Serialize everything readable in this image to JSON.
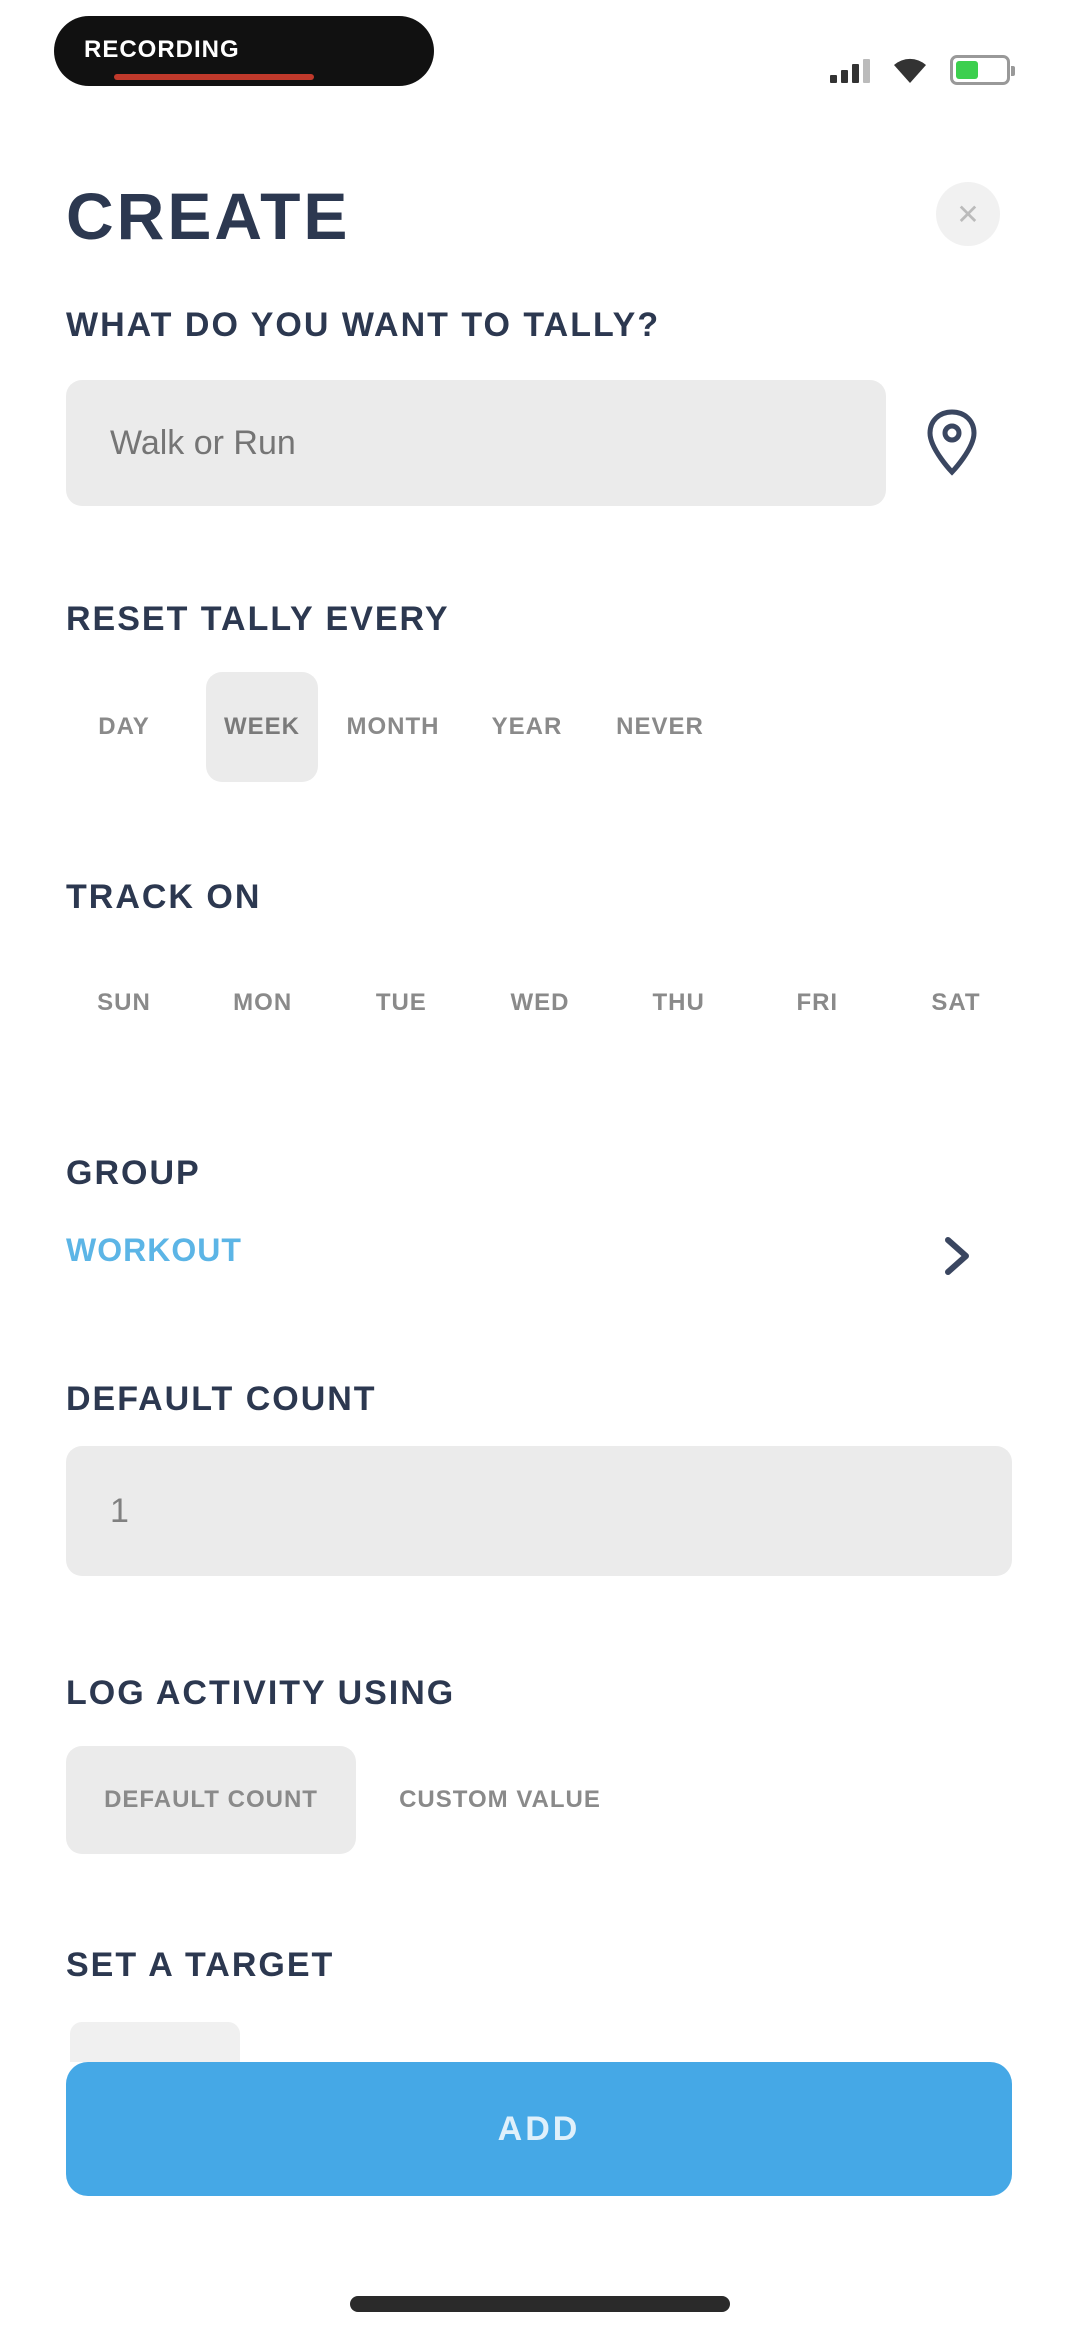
{
  "status_bar": {
    "recording_label": "RECORDING",
    "battery_color": "#3ccf4e",
    "icons": [
      "signal-icon",
      "wifi-icon",
      "battery-icon"
    ]
  },
  "header": {
    "title": "CREATE",
    "close_icon": "close-icon"
  },
  "tally": {
    "label": "WHAT DO YOU WANT TO TALLY?",
    "placeholder": "Walk or Run",
    "location_icon": "location-pin-icon"
  },
  "reset": {
    "label": "RESET TALLY EVERY",
    "options": [
      "DAY",
      "WEEK",
      "MONTH",
      "YEAR",
      "NEVER"
    ],
    "selected": "WEEK"
  },
  "track": {
    "label": "TRACK ON",
    "days": [
      "SUN",
      "MON",
      "TUE",
      "WED",
      "THU",
      "FRI",
      "SAT"
    ]
  },
  "group": {
    "label": "GROUP",
    "value": "WORKOUT",
    "accent_color": "#5cb5e6"
  },
  "default_count": {
    "label": "DEFAULT COUNT",
    "value": "1"
  },
  "log_activity": {
    "label": "LOG ACTIVITY USING",
    "options": [
      "DEFAULT COUNT",
      "CUSTOM VALUE"
    ],
    "selected": "DEFAULT COUNT"
  },
  "target": {
    "label": "SET A TARGET"
  },
  "add_button": {
    "label": "ADD",
    "color": "#45a8e6"
  }
}
